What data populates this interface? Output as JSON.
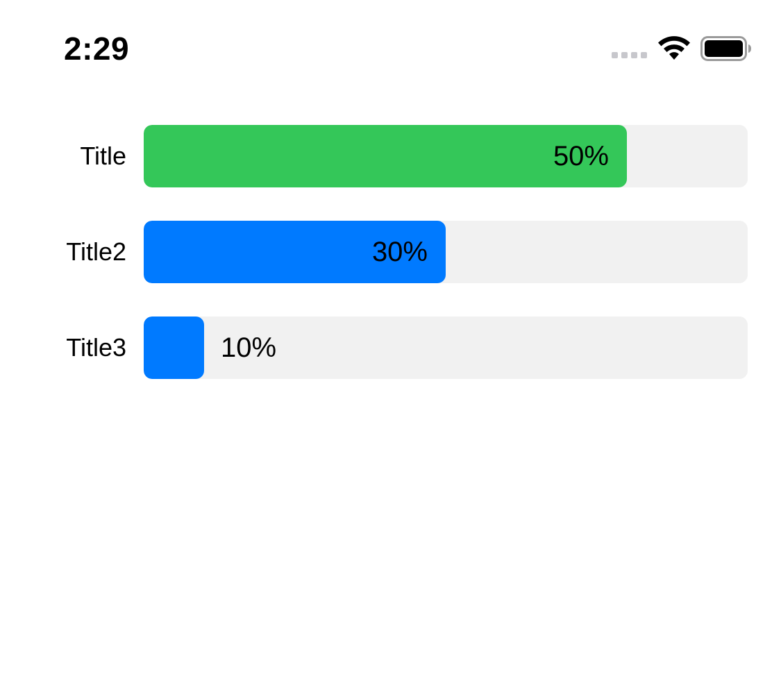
{
  "status_bar": {
    "time": "2:29",
    "signal_color": "#c7c7cc",
    "icons": [
      "cellular-signal-icon",
      "wifi-icon",
      "battery-icon"
    ]
  },
  "rows": [
    {
      "title": "Title",
      "percent_label": "50%",
      "fill_fraction": 0.8,
      "color": "#34c759",
      "label_inside": true
    },
    {
      "title": "Title2",
      "percent_label": "30%",
      "fill_fraction": 0.5,
      "color": "#007aff",
      "label_inside": true
    },
    {
      "title": "Title3",
      "percent_label": "10%",
      "fill_fraction": 0.1,
      "color": "#007aff",
      "label_inside": false
    }
  ],
  "colors": {
    "track": "#f1f1f1",
    "green": "#34c759",
    "blue": "#007aff"
  }
}
